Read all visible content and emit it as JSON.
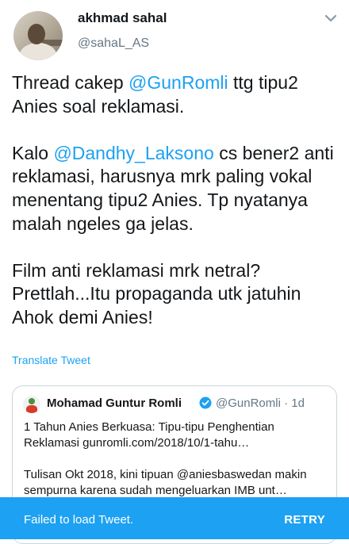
{
  "author": {
    "display_name": "akhmad sahal",
    "handle": "@sahaL_AS"
  },
  "tweet": {
    "paragraph1": {
      "pre": "Thread cakep ",
      "mention": "@GunRomli",
      "post": " ttg tipu2 Anies soal reklamasi."
    },
    "paragraph2": {
      "pre": "Kalo ",
      "mention": "@Dandhy_Laksono",
      "post": " cs bener2 anti reklamasi, harusnya mrk paling vokal menentang tipu2 Anies. Tp nyatanya malah ngeles ga jelas."
    },
    "paragraph3": "Film anti reklamasi mrk netral? Prettlah...Itu propaganda utk jatuhin Ahok demi Anies!",
    "translate_label": "Translate Tweet"
  },
  "quoted_tweet": {
    "name": "Mohamad Guntur Romli",
    "handle_time": "@GunRomli · 1d",
    "line1": "1 Tahun Anies Berkuasa: Tipu-tipu Penghentian Reklamasi  gunromli.com/2018/10/1-tahu…",
    "line2": "Tulisan Okt 2018, kini tipuan @aniesbaswedan makin sempurna karena sudah mengeluarkan IMB unt…"
  },
  "snackbar": {
    "message": "Failed to load Tweet.",
    "action": "RETRY"
  },
  "colors": {
    "accent": "#1da1f2",
    "text": "#14171a",
    "muted": "#657786",
    "border": "#ccd6dd"
  }
}
